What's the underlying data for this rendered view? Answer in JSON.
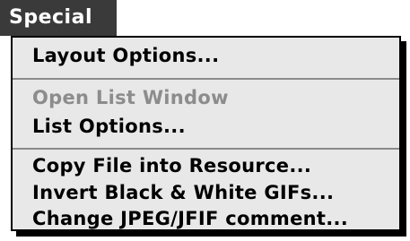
{
  "menu": {
    "title": "Special",
    "items": [
      {
        "label": "Layout Options...",
        "enabled": true
      },
      {
        "label": "Open List Window",
        "enabled": false
      },
      {
        "label": "List Options...",
        "enabled": true
      },
      {
        "label": "Copy File into Resource...",
        "enabled": true
      },
      {
        "label": "Invert Black & White GIFs...",
        "enabled": true
      },
      {
        "label": "Change JPEG/JFIF comment...",
        "enabled": true
      }
    ]
  },
  "colors": {
    "menu_background": "#e8e8e8",
    "title_background": "#3a3a3a",
    "disabled_text": "#8c8c8c",
    "separator": "#8a8a8a"
  }
}
